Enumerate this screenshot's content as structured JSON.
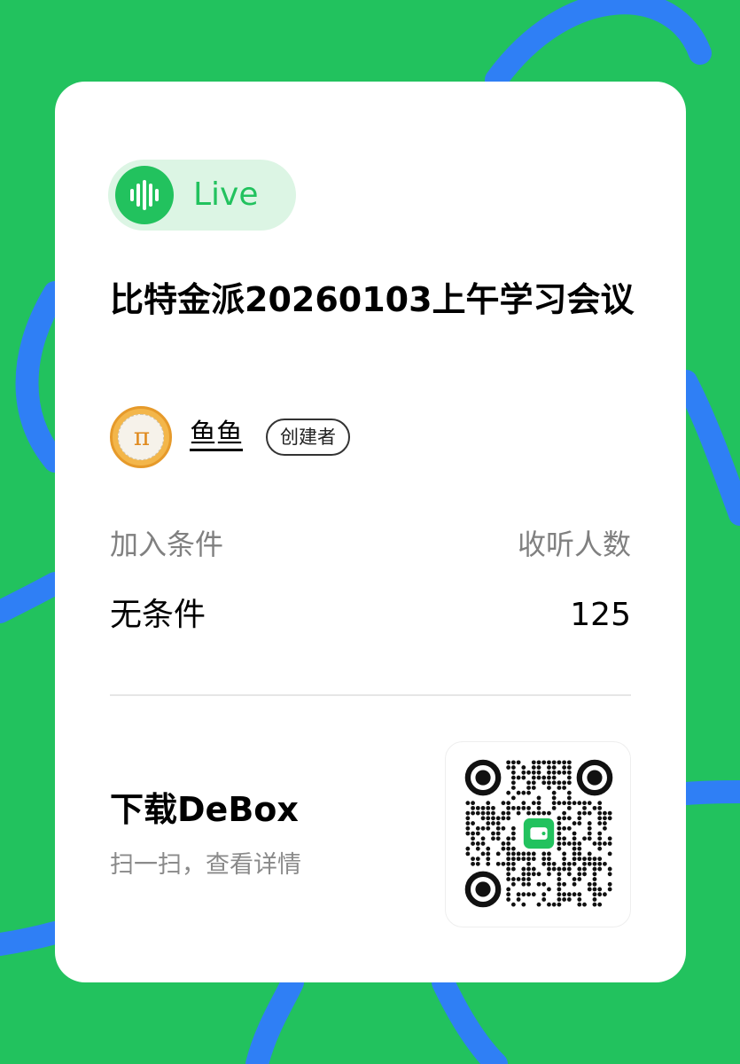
{
  "colors": {
    "background": "#22c25e",
    "curve": "#2f7ff5",
    "accent": "#22c25e",
    "card": "#ffffff"
  },
  "live_badge": {
    "icon": "audio-wave-icon",
    "label": "Live"
  },
  "room": {
    "title": "比特金派20260103上午学习会议"
  },
  "creator": {
    "avatar_icon": "pi-avatar-icon",
    "name": "鱼鱼",
    "role": "创建者"
  },
  "info": {
    "join_condition_label": "加入条件",
    "join_condition_value": "无条件",
    "listeners_label": "收听人数",
    "listeners_value": "125"
  },
  "download": {
    "title": "下载DeBox",
    "subtitle": "扫一扫，查看详情",
    "qr_icon": "qr-code-icon",
    "qr_logo_icon": "wallet-logo-icon"
  }
}
